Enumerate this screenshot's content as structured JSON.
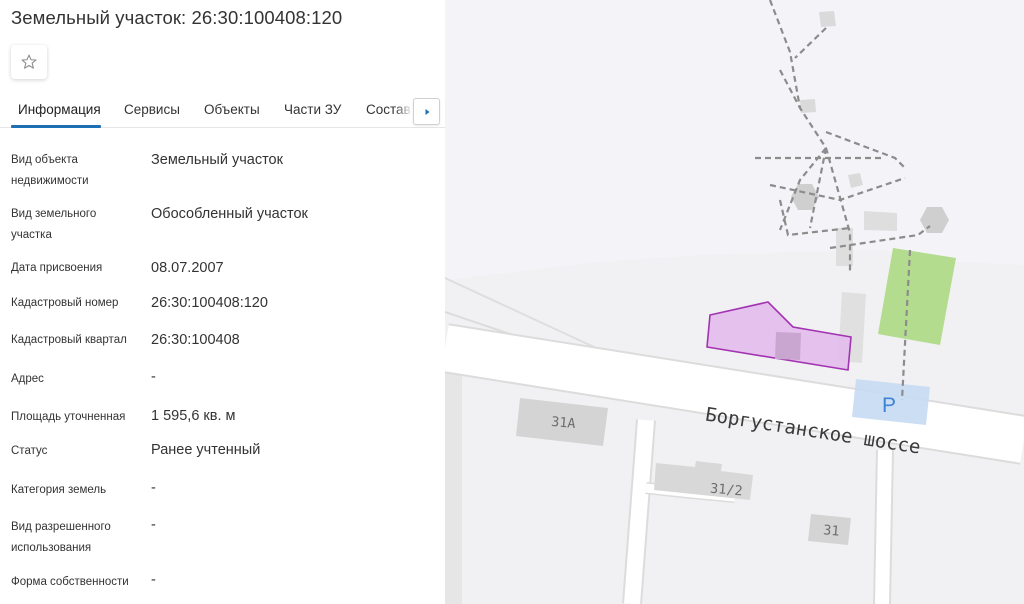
{
  "header": {
    "title": "Земельный участок: 26:30:100408:120"
  },
  "tabs": [
    {
      "label": "Информация",
      "active": true
    },
    {
      "label": "Сервисы"
    },
    {
      "label": "Объекты"
    },
    {
      "label": "Части ЗУ"
    },
    {
      "label": "Состав"
    }
  ],
  "fields": [
    {
      "label": "Вид объекта недвижимости",
      "value": "Земельный участок"
    },
    {
      "label": "Вид земельного участка",
      "value": "Обособленный участок"
    },
    {
      "label": "Дата присвоения",
      "value": "08.07.2007"
    },
    {
      "label": "Кадастровый номер",
      "value": "26:30:100408:120"
    },
    {
      "label": "Кадастровый квартал",
      "value": "26:30:100408"
    },
    {
      "label": "Адрес",
      "value": "-"
    },
    {
      "label": "Площадь уточненная",
      "value": "1 595,6 кв. м"
    },
    {
      "label": "Статус",
      "value": "Ранее учтенный"
    },
    {
      "label": "Категория земель",
      "value": "-"
    },
    {
      "label": "Вид разрешенного использования",
      "value": "-"
    },
    {
      "label": "Форма собственности",
      "value": "-"
    }
  ],
  "map": {
    "road_name": "Боргустанское шоссе",
    "labels": {
      "house_31a": "31А",
      "house_31_2": "31/2",
      "house_31": "31"
    },
    "parking_symbol": "P",
    "colors": {
      "background": "#f1f1f3",
      "parcel_fill": "#e3b8ec",
      "parcel_stroke": "#a233b1",
      "green_area": "#b3dc8e",
      "parking": "#c7daf2",
      "road": "#ffffff",
      "building": "#d4d4d4"
    }
  }
}
